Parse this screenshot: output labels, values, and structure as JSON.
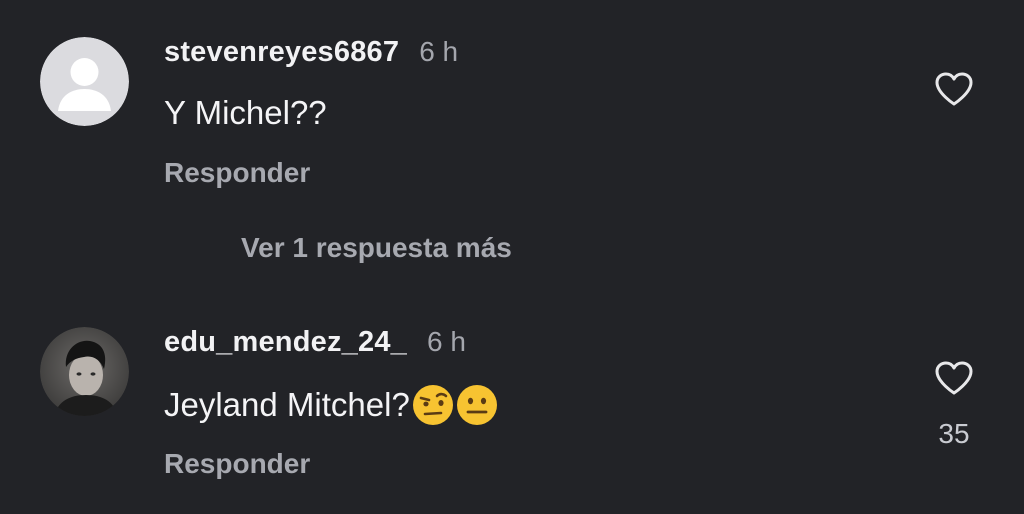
{
  "comments": [
    {
      "username": "stevenreyes6867",
      "time": "6 h",
      "text": "Y Michel??",
      "reply_label": "Responder",
      "like_count": "",
      "avatar": "default-avatar"
    },
    {
      "username": "edu_mendez_24_",
      "time": "6 h",
      "text": "Jeyland Mitchel?",
      "emojis": [
        "raised-eyebrow-emoji",
        "neutral-face-emoji"
      ],
      "reply_label": "Responder",
      "like_count": "35",
      "avatar": "user-photo"
    }
  ],
  "thread": {
    "view_more_label": "Ver 1 respuesta más"
  },
  "colors": {
    "background": "#222327",
    "primary_text": "#f2f2f4",
    "secondary_text": "#a7a9b0",
    "heart_outline": "#e8e8ea"
  }
}
